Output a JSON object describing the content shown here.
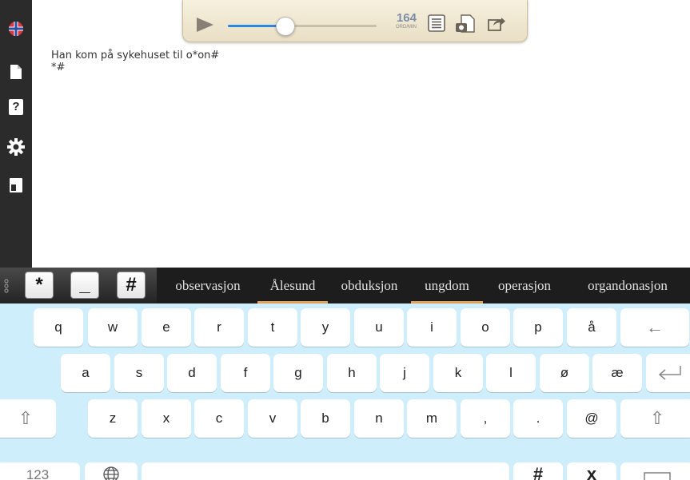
{
  "toolbar": {
    "speed_value": "164",
    "speed_unit": "ORD/MIN",
    "slider_position": 0.38
  },
  "document": {
    "line1": "Han kom på sykehuset til o*on#",
    "line2": "*#"
  },
  "sidebar": {
    "items": [
      {
        "icon": "flag-icon"
      },
      {
        "icon": "document-icon"
      },
      {
        "icon": "help-icon",
        "label": "?"
      },
      {
        "icon": "gear-icon"
      },
      {
        "icon": "layout-icon"
      }
    ]
  },
  "symbols": [
    "*",
    "_",
    "#"
  ],
  "suggestions": [
    {
      "word": "observasjon",
      "underlined": false
    },
    {
      "word": "Ålesund",
      "underlined": true
    },
    {
      "word": "obduksjon",
      "underlined": false
    },
    {
      "word": "ungdom",
      "underlined": true
    },
    {
      "word": "operasjon",
      "underlined": false
    },
    {
      "word": "organdonasjon",
      "underlined": false
    }
  ],
  "keyboard": {
    "row1": [
      "q",
      "w",
      "e",
      "r",
      "t",
      "y",
      "u",
      "i",
      "o",
      "p",
      "å",
      "←"
    ],
    "row2": [
      "a",
      "s",
      "d",
      "f",
      "g",
      "h",
      "j",
      "k",
      "l",
      "ø",
      "æ"
    ],
    "row3": [
      "⇧",
      "z",
      "x",
      "c",
      "v",
      "b",
      "n",
      "m",
      ",",
      ".",
      "@",
      "⇧"
    ],
    "row4_left": "123",
    "row4_hash": "#",
    "row4_x": "x"
  },
  "colors": {
    "accent_blue": "#2f85e0",
    "suggestion_underline": "#e0a25a",
    "keyboard_bg": "#cfeefb"
  }
}
